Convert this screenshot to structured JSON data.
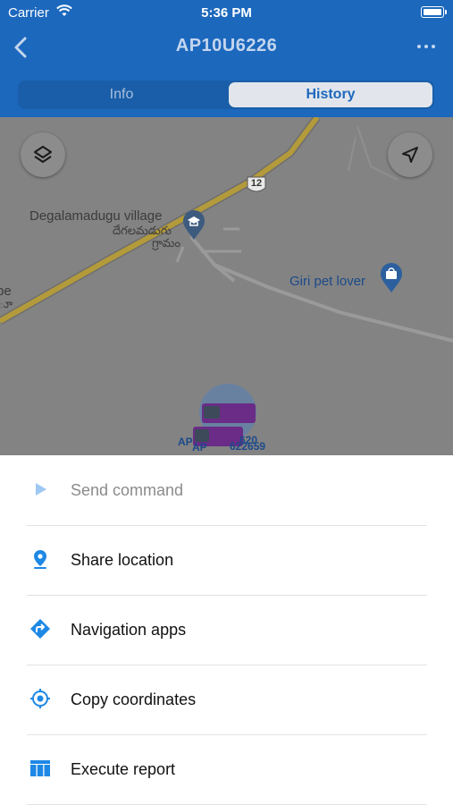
{
  "status_bar": {
    "carrier": "Carrier",
    "time": "5:36 PM"
  },
  "header": {
    "title": "AP10U6226"
  },
  "tabs": [
    {
      "label": "Info",
      "selected": false
    },
    {
      "label": "History",
      "selected": true
    }
  ],
  "map": {
    "places": [
      {
        "name": "Degalamadugu village",
        "local_name": "దేగలమడుగు",
        "local_name_2": "గ్రామం"
      },
      {
        "name": "Giri pet lover"
      }
    ],
    "partial_labels": [
      "pe",
      "ూ"
    ],
    "route_shield": "12",
    "vehicle_labels": [
      "AP",
      "AP",
      "622659",
      "620"
    ]
  },
  "menu": [
    {
      "label": "Send command",
      "icon": "play-icon",
      "enabled": false
    },
    {
      "label": "Share location",
      "icon": "location-pin-icon",
      "enabled": true
    },
    {
      "label": "Navigation apps",
      "icon": "directions-icon",
      "enabled": true
    },
    {
      "label": "Copy coordinates",
      "icon": "crosshair-icon",
      "enabled": true
    },
    {
      "label": "Execute report",
      "icon": "table-icon",
      "enabled": true
    }
  ],
  "colors": {
    "header": "#1c68bd",
    "accent": "#1e88e5",
    "map_dim": "#838383",
    "road": "#b39a3a"
  }
}
